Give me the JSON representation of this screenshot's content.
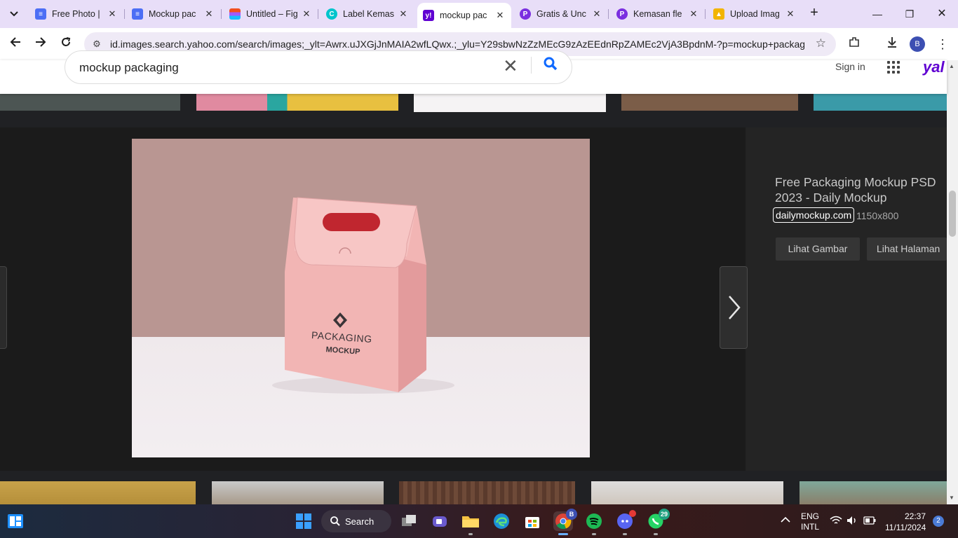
{
  "browser": {
    "tabs": [
      {
        "title": "Free Photo |",
        "icon": "docs-icon",
        "color": "#4c6ef5",
        "active": false
      },
      {
        "title": "Mockup pac",
        "icon": "docs-icon",
        "color": "#4c6ef5",
        "active": false
      },
      {
        "title": "Untitled – Fig",
        "icon": "figma-icon",
        "color": "#f24e1e",
        "active": false
      },
      {
        "title": "Label Kemas",
        "icon": "canva-icon",
        "color": "#00c4cc",
        "active": false
      },
      {
        "title": "mockup pac",
        "icon": "yahoo-icon",
        "color": "#6001d2",
        "active": true
      },
      {
        "title": "Gratis & Unc",
        "icon": "picsart-icon",
        "color": "#7b2fe0",
        "active": false
      },
      {
        "title": "Kemasan fle",
        "icon": "picsart-icon",
        "color": "#7b2fe0",
        "active": false
      },
      {
        "title": "Upload Imag",
        "icon": "upload-icon",
        "color": "#f2b400",
        "active": false
      }
    ],
    "url": "id.images.search.yahoo.com/search/images;_ylt=Awrx.uJXGjJnMAIA2wfLQwx.;_ylu=Y29sbwNzZzMEcG9zAzEEdnRpZAMEc2VjA3BpdnM-?p=mockup+packaging...",
    "profile_initial": "B"
  },
  "search": {
    "query": "mockup packaging",
    "signin_label": "Sign in",
    "logo_text": "yal"
  },
  "viewer": {
    "title": "Free Packaging Mockup PSD 2023 - Daily Mockup",
    "source": "dailymockup.com",
    "dimensions": "1150x800",
    "view_image_label": "Lihat Gambar",
    "view_page_label": "Lihat Halaman",
    "bag_text_line1": "PACKAGING",
    "bag_text_line2": "MOCKUP"
  },
  "taskbar": {
    "search_label": "Search",
    "chrome_badge": "B",
    "whatsapp_badge": "29",
    "lang_line1": "ENG",
    "lang_line2": "INTL",
    "time": "22:37",
    "date": "11/11/2024",
    "notifications": "2"
  }
}
